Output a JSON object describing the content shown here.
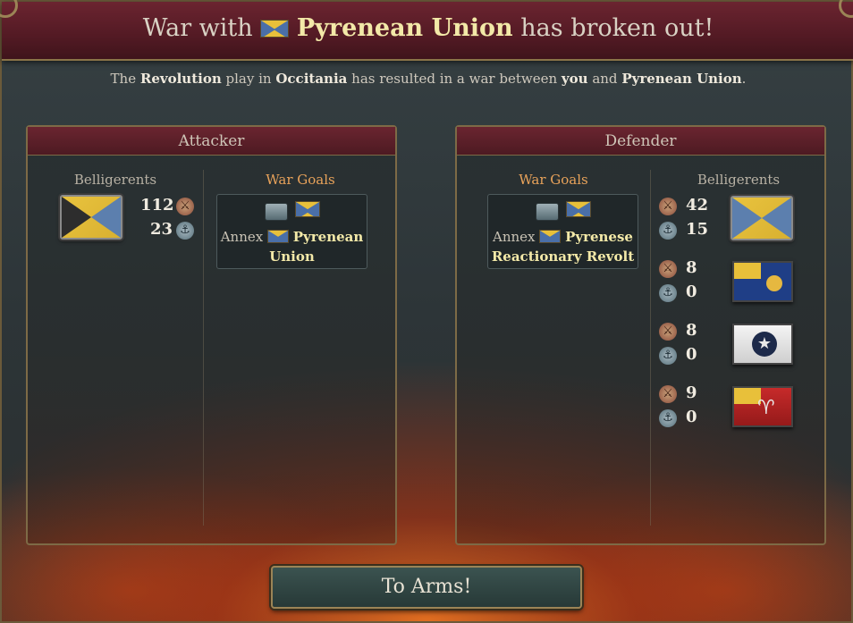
{
  "header": {
    "title_prefix": "War with",
    "title_country": "Pyrenean Union",
    "title_suffix": "has broken out!"
  },
  "subtitle": {
    "t1": "The",
    "play": "Revolution",
    "t2": "play in",
    "region": "Occitania",
    "t3": "has resulted in a war between",
    "you": "you",
    "t4": "and",
    "country": "Pyrenean Union",
    "t5": "."
  },
  "attacker": {
    "header": "Attacker",
    "belligerents_label": "Belligerents",
    "war_goals_label": "War Goals",
    "belligerents": [
      {
        "flag": "split-yellow-blue",
        "army": "112",
        "navy": "23"
      }
    ],
    "war_goal": {
      "verb": "Annex",
      "target_line1": "Pyrenean",
      "target_line2": "Union"
    }
  },
  "defender": {
    "header": "Defender",
    "belligerents_label": "Belligerents",
    "war_goals_label": "War Goals",
    "belligerents": [
      {
        "flag": "yellow-blue",
        "army": "42",
        "navy": "15"
      },
      {
        "flag": "blue-sun",
        "army": "8",
        "navy": "0"
      },
      {
        "flag": "white-star",
        "army": "8",
        "navy": "0"
      },
      {
        "flag": "red-bird",
        "army": "9",
        "navy": "0"
      }
    ],
    "war_goal": {
      "verb": "Annex",
      "target_line1": "Pyrenese",
      "target_line2": "Reactionary Revolt"
    }
  },
  "button": {
    "label": "To Arms!"
  },
  "icons": {
    "army": "musket-soldier-icon",
    "navy": "anchor-icon",
    "star": "★",
    "bird": "♈"
  },
  "colors": {
    "header_red": "#6b2430",
    "gold_text": "#f3e9a8",
    "goal_orange": "#e8a25a",
    "border_gold": "#7d6a46"
  }
}
